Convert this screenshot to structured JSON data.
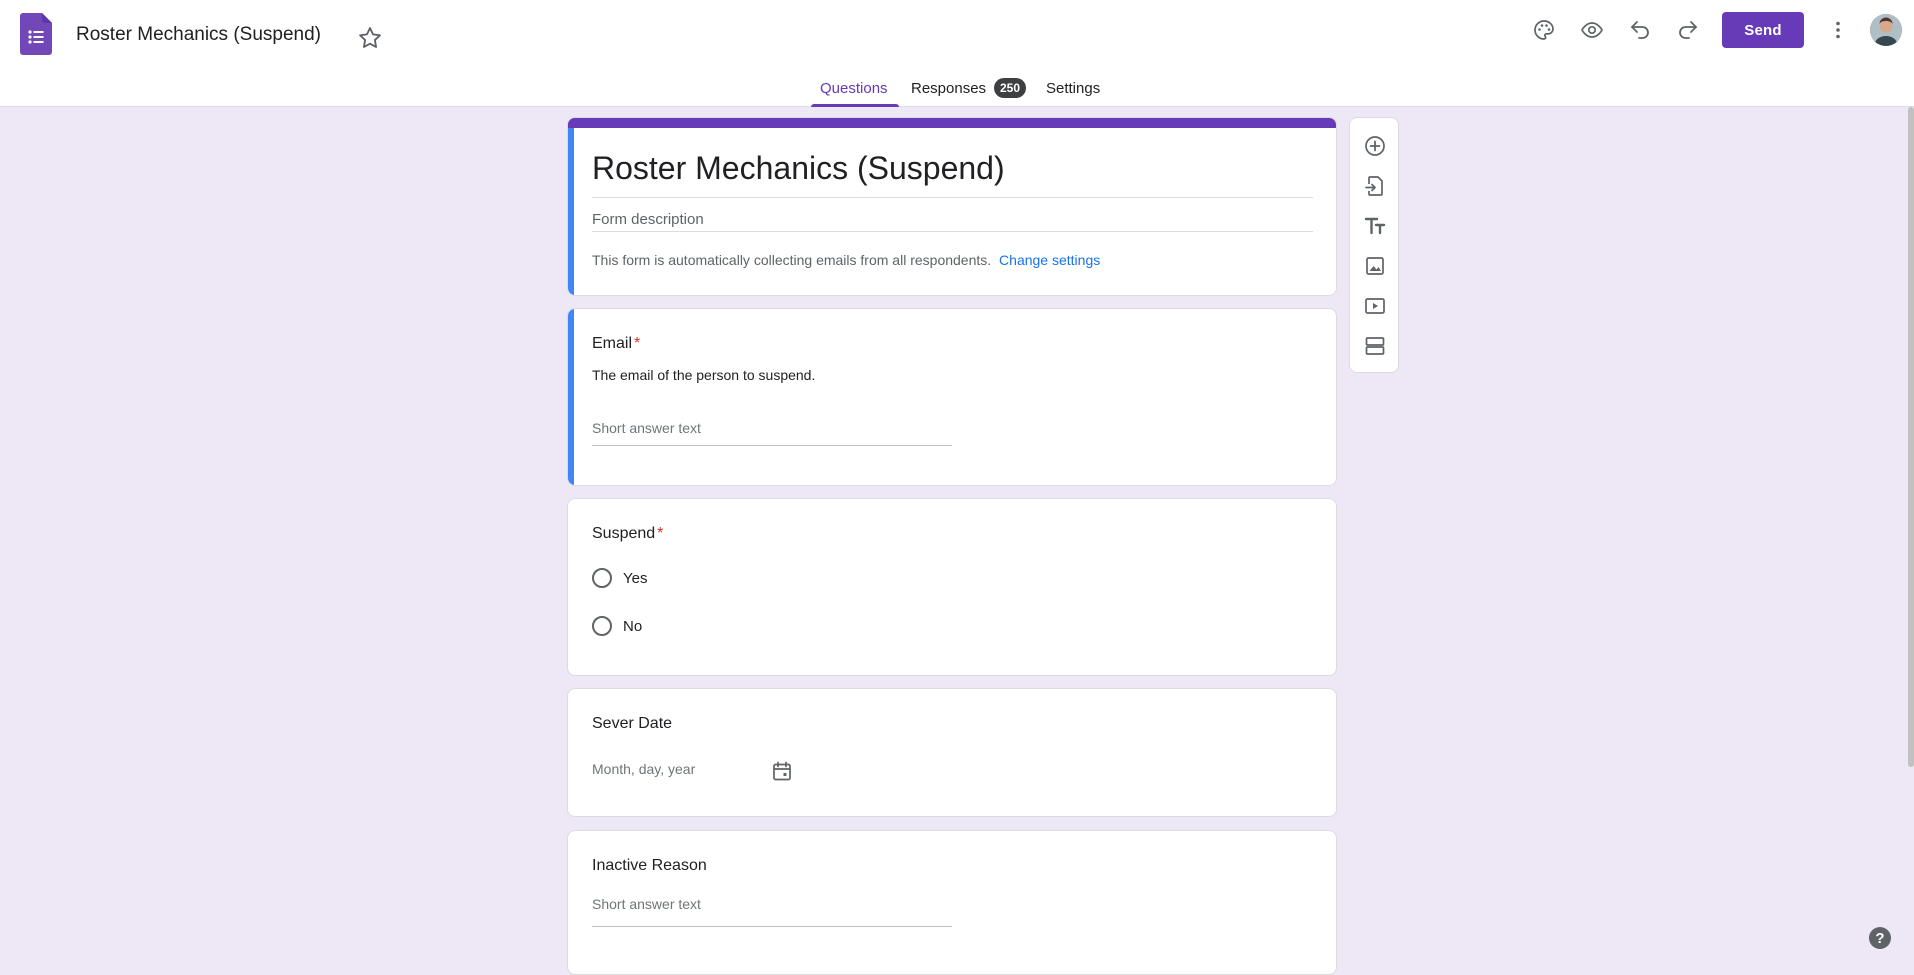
{
  "header": {
    "doc_title": "Roster Mechanics (Suspend)",
    "send_label": "Send",
    "icons": [
      "palette-icon",
      "preview-icon",
      "undo-icon",
      "redo-icon",
      "more-vert-icon"
    ]
  },
  "tabs": [
    {
      "label": "Questions",
      "active": true
    },
    {
      "label": "Responses",
      "badge": "250"
    },
    {
      "label": "Settings"
    }
  ],
  "form": {
    "title": "Roster Mechanics (Suspend)",
    "description_placeholder": "Form description",
    "collect_note": "This form is automatically collecting emails from all respondents.",
    "change_settings": "Change settings"
  },
  "questions": [
    {
      "title": "Email",
      "required": true,
      "description": "The email of the person to suspend.",
      "type": "short",
      "placeholder": "Short answer text"
    },
    {
      "title": "Suspend",
      "required": true,
      "type": "radio",
      "options": [
        "Yes",
        "No"
      ]
    },
    {
      "title": "Sever Date",
      "required": false,
      "type": "date",
      "placeholder": "Month, day, year"
    },
    {
      "title": "Inactive Reason",
      "required": false,
      "type": "short",
      "placeholder": "Short answer text"
    }
  ],
  "toolbar": [
    "add-question-icon",
    "import-questions-icon",
    "add-title-icon",
    "add-image-icon",
    "add-video-icon",
    "add-section-icon"
  ],
  "help_label": "?",
  "colors": {
    "accent": "#673ab7",
    "selected": "#4285f4",
    "background": "#ede7f6",
    "link": "#1a73e8",
    "required": "#d93025"
  }
}
